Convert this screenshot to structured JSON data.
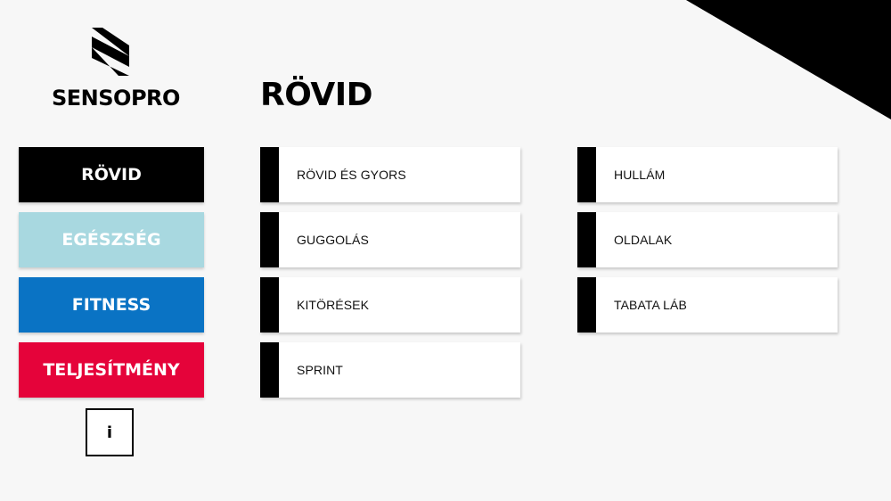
{
  "brand": {
    "name": "SENSOPRO"
  },
  "page": {
    "title": "RÖVID"
  },
  "sidebar": {
    "items": [
      {
        "label": "RÖVID",
        "color": "#000000"
      },
      {
        "label": "EGÉSZSÉG",
        "color": "#a8d8e0"
      },
      {
        "label": "FITNESS",
        "color": "#0a73c4"
      },
      {
        "label": "TELJESÍTMÉNY",
        "color": "#e5033a"
      }
    ],
    "info_label": "i"
  },
  "programs": {
    "column1": [
      "RÖVID ÉS GYORS",
      "GUGGOLÁS",
      "KITÖRÉSEK",
      "SPRINT"
    ],
    "column2": [
      "HULLÁM",
      "OLDALAK",
      "TABATA LÁB"
    ]
  }
}
